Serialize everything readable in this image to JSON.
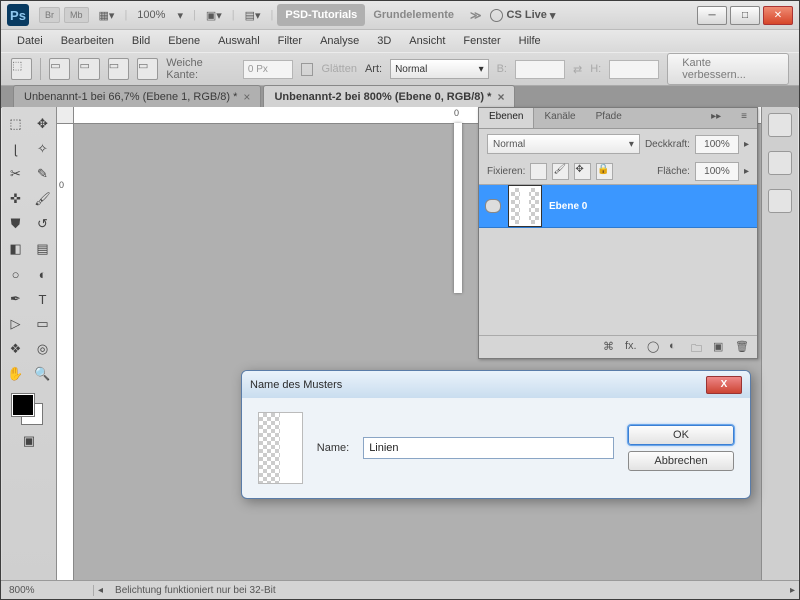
{
  "title_badges": [
    "Br",
    "Mb"
  ],
  "zoom_titlebar": "100%",
  "tabs_header": {
    "active": "PSD-Tutorials",
    "inactive": "Grundelemente"
  },
  "cslive": "CS Live",
  "menubar": [
    "Datei",
    "Bearbeiten",
    "Bild",
    "Ebene",
    "Auswahl",
    "Filter",
    "Analyse",
    "3D",
    "Ansicht",
    "Fenster",
    "Hilfe"
  ],
  "optbar": {
    "weiche": "Weiche Kante:",
    "weiche_val": "0 Px",
    "glaetten": "Glätten",
    "art": "Art:",
    "art_val": "Normal",
    "b": "B:",
    "h": "H:",
    "kante": "Kante verbessern..."
  },
  "doctabs": [
    {
      "label": "Unbenannt-1 bei 66,7% (Ebene 1, RGB/8) *",
      "active": false
    },
    {
      "label": "Unbenannt-2 bei 800% (Ebene 0, RGB/8) *",
      "active": true
    }
  ],
  "panel": {
    "tabs": [
      "Ebenen",
      "Kanäle",
      "Pfade"
    ],
    "blend": "Normal",
    "opacity_lbl": "Deckkraft:",
    "opacity_val": "100%",
    "fix_lbl": "Fixieren:",
    "fill_lbl": "Fläche:",
    "fill_val": "100%",
    "layer0": "Ebene 0"
  },
  "modal": {
    "title": "Name des Musters",
    "name_lbl": "Name:",
    "name_val": "Linien",
    "ok": "OK",
    "cancel": "Abbrechen"
  },
  "status": {
    "zoom": "800%",
    "msg": "Belichtung funktioniert nur bei 32-Bit"
  },
  "ruler_origin": "0"
}
